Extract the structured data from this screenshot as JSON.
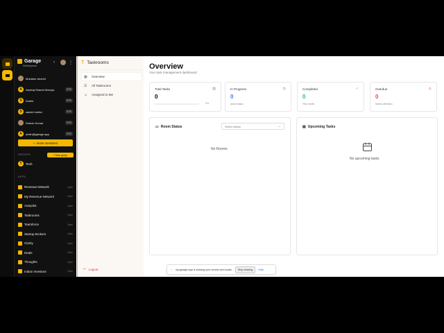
{
  "workspace": {
    "name": "Garage",
    "sub": "Workspace"
  },
  "members": [
    {
      "name": "Mubasis Javeed",
      "badge": "",
      "photo": true
    },
    {
      "name": "Aswiraj Shared Maurya",
      "badge": "GTE",
      "initial": "A"
    },
    {
      "name": "Sudhir",
      "badge": "GTE",
      "initial": "S"
    },
    {
      "name": "sakshi mohta",
      "badge": "GTE",
      "initial": "S"
    },
    {
      "name": "Dinesh Kumar",
      "badge": "GTE",
      "photo": true
    },
    {
      "name": "anish@garage.app",
      "badge": "GTE",
      "initial": "A"
    }
  ],
  "invite_label": "Invite members",
  "groups_label": "GROUPS",
  "new_group_label": "New group",
  "group": {
    "initial": "T",
    "name": "Tech"
  },
  "apps_label": "APPS",
  "apps": [
    {
      "name": "Revenue Network",
      "open": "Open"
    },
    {
      "name": "My Revenue Network",
      "open": "Open"
    },
    {
      "name": "Autopilot",
      "open": "Open"
    },
    {
      "name": "Taskrooms",
      "open": "Open"
    },
    {
      "name": "Teamforce",
      "open": "Open"
    },
    {
      "name": "Startup Brokers",
      "open": "Open"
    },
    {
      "name": "Clarity",
      "open": "Open"
    },
    {
      "name": "Deals",
      "open": "Open"
    },
    {
      "name": "Thoughts",
      "open": "Open"
    },
    {
      "name": "Indian Investors",
      "open": "Open"
    }
  ],
  "panel": {
    "title": "Taskrooms",
    "nav": [
      "Overview",
      "All Taskrooms",
      "Assigned to Me"
    ],
    "logout": "Logout"
  },
  "main": {
    "title": "Overview",
    "subtitle": "Your task management dashboard",
    "stats": [
      {
        "label": "Total Tasks",
        "value": "0",
        "pct": "0%",
        "progress": 0,
        "color": "#111"
      },
      {
        "label": "In Progress",
        "value": "0",
        "sub": "Active tasks",
        "color": "#3b82f6"
      },
      {
        "label": "Completed",
        "value": "0",
        "sub": "This month",
        "color": "#22c55e"
      },
      {
        "label": "Overdue",
        "value": "0",
        "sub": "Needs attention",
        "color": "#ef4444"
      }
    ],
    "room_status": {
      "title": "Room Status",
      "select_placeholder": "Select status",
      "empty": "No Rooms"
    },
    "upcoming": {
      "title": "Upcoming Tasks",
      "empty": "No upcoming tasks"
    }
  },
  "share_bar": {
    "text": "my.garage.app is sharing your screen and audio.",
    "stop": "Stop sharing",
    "hide": "Hide"
  }
}
